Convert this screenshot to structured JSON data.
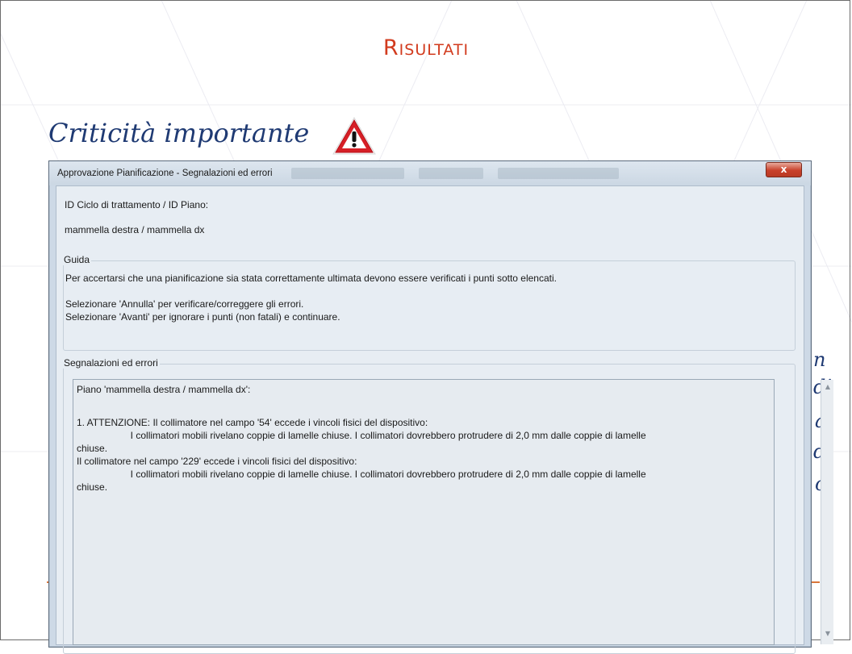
{
  "slide": {
    "title": "Risultati",
    "subtitle": "Criticità importante",
    "right_fragments": [
      "n",
      "di",
      "a",
      "di",
      "o"
    ]
  },
  "dialog": {
    "title": "Approvazione Pianificazione - Segnalazioni ed errori",
    "close_label": "x",
    "id_label": "ID Ciclo di trattamento / ID Piano:",
    "id_value": "mammella destra / mammella dx",
    "guide": {
      "legend": "Guida",
      "line1": "Per accertarsi che una pianificazione sia stata correttamente ultimata devono essere verificati i punti sotto elencati.",
      "line2": "Selezionare 'Annulla' per verificare/correggere gli errori.",
      "line3": "Selezionare 'Avanti' per ignorare i punti (non fatali) e continuare."
    },
    "warnings": {
      "legend": "Segnalazioni ed errori",
      "lines": [
        "Piano 'mammella destra / mammella dx':",
        "",
        "1. ATTENZIONE: Il collimatore nel campo '54' eccede i vincoli fisici del dispositivo:",
        "                    I collimatori mobili rivelano coppie di lamelle chiuse. I collimatori dovrebbero protrudere di 2,0 mm dalle coppie di lamelle",
        "chiuse.",
        "Il collimatore nel campo '229' eccede i vincoli fisici del dispositivo:",
        "                    I collimatori mobili rivelano coppie di lamelle chiuse. I collimatori dovrebbero protrudere di 2,0 mm dalle coppie di lamelle",
        "chiuse."
      ]
    }
  }
}
